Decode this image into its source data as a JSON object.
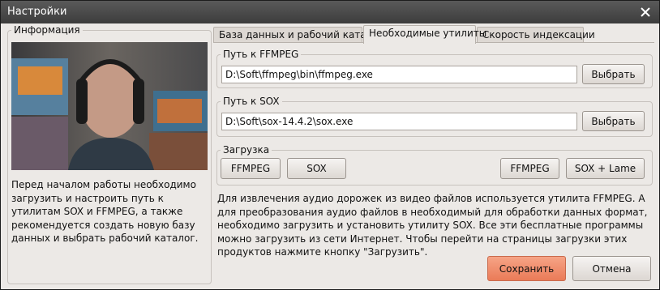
{
  "window": {
    "title": "Настройки"
  },
  "info": {
    "legend": "Информация",
    "text": "Перед началом работы необходимо загрузить и настроить путь к утилитам SOX и FFMPEG, а также рекомендуется создать новую базу данных и выбрать рабочий каталог."
  },
  "tabs": [
    {
      "label": "База данных и рабочий каталог"
    },
    {
      "label": "Необходимые утилиты"
    },
    {
      "label": "Скорость индексации"
    }
  ],
  "ffmpeg": {
    "legend": "Путь к FFMPEG",
    "path": "D:\\Soft\\ffmpeg\\bin\\ffmpeg.exe",
    "browse_label": "Выбрать"
  },
  "sox": {
    "legend": "Путь к SOX",
    "path": "D:\\Soft\\sox-14.4.2\\sox.exe",
    "browse_label": "Выбрать"
  },
  "download": {
    "legend": "Загрузка",
    "buttons": [
      "FFMPEG",
      "SOX",
      "FFMPEG",
      "SOX + Lame"
    ]
  },
  "help_text": "Для извлечения аудио дорожек из видео файлов используется утилита FFMPEG. А для преобразования аудио файлов в необходимый для обработки данных формат, необходимо загрузить и установить утилиту SOX. Все эти бесплатные программы можно загрузить из сети Интернет. Чтобы перейти на страницы загрузки этих продуктов нажмите кнопку \"Загрузить\".",
  "footer": {
    "save_label": "Сохранить",
    "cancel_label": "Отмена"
  },
  "colors": {
    "save_accent": "#ea7b58",
    "window_bg": "#ece9e6",
    "titlebar": "#4a4a4a"
  }
}
